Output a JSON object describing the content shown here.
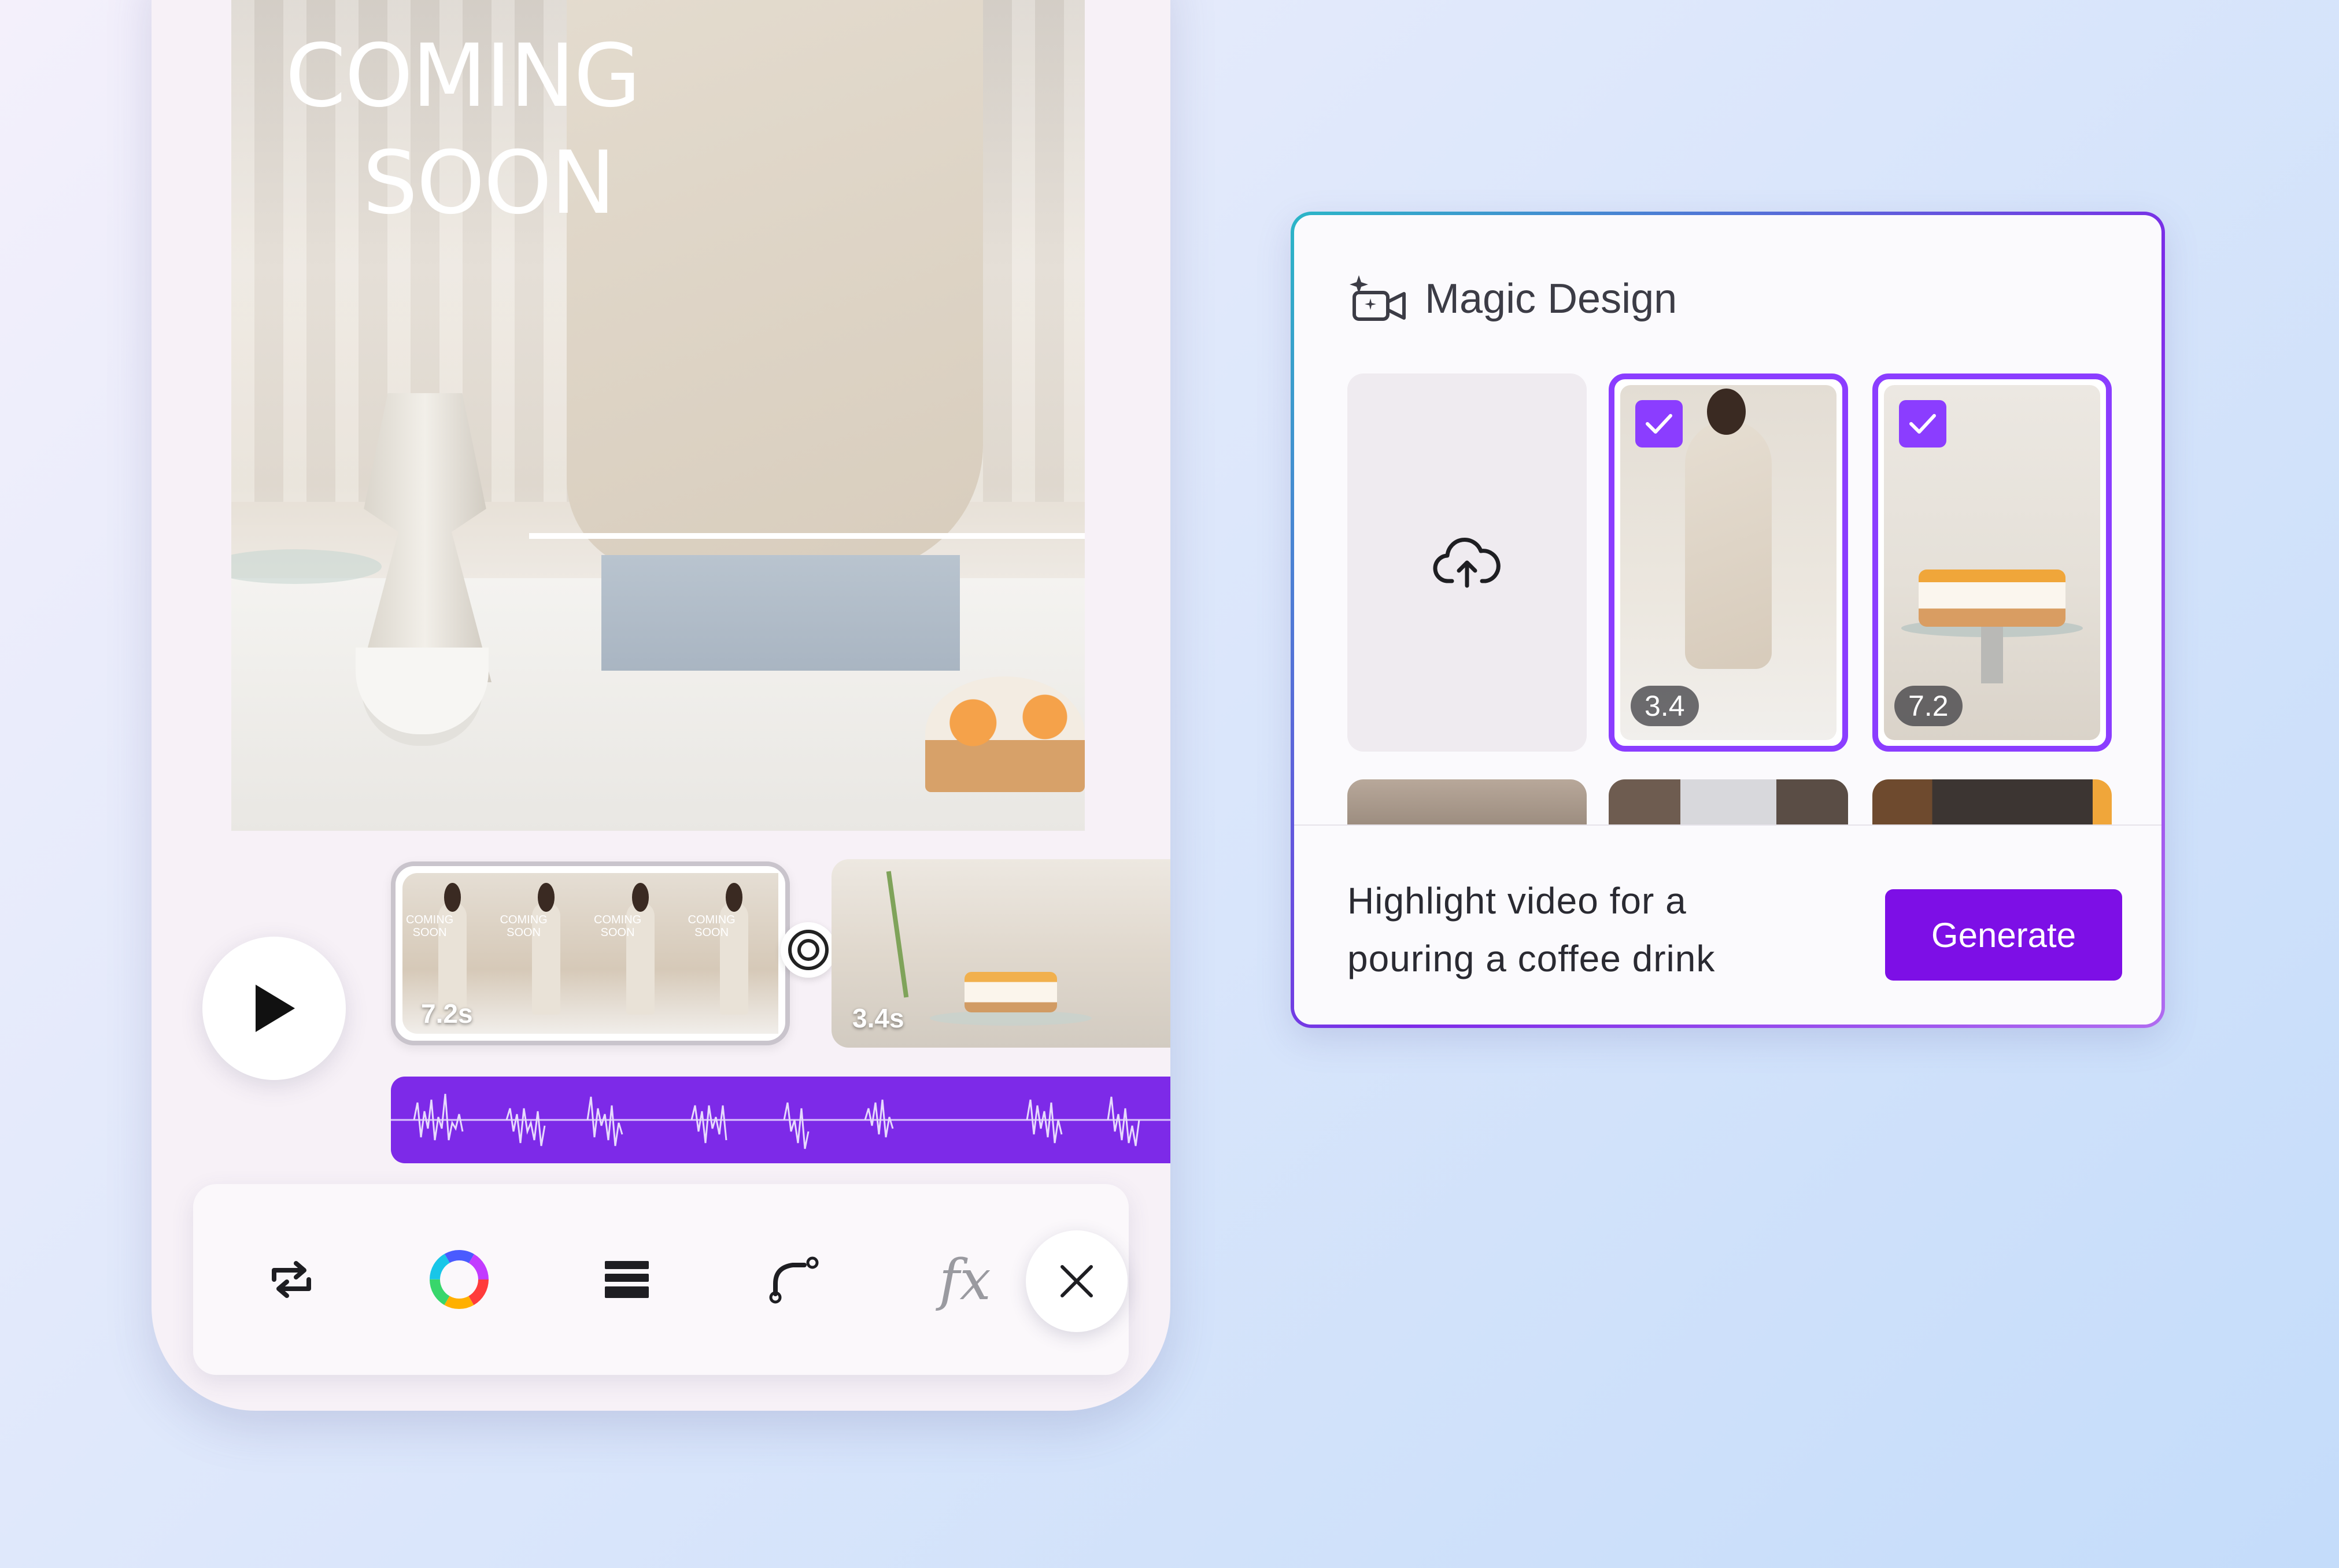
{
  "video": {
    "title_line1": "COMING",
    "title_line2": "SOON"
  },
  "timeline": {
    "clip1_duration": "7.2s",
    "clip1_thumb_text_line1": "COMING",
    "clip1_thumb_text_line2": "SOON",
    "clip2_duration": "3.4s"
  },
  "toolbar": {
    "tools": [
      "replace-icon",
      "color-wheel-icon",
      "layers-icon",
      "curve-icon",
      "effects-icon"
    ],
    "fx_label": "fx",
    "close_icon": "close-icon"
  },
  "panel": {
    "title": "Magic Design",
    "tiles": [
      {
        "duration": "3.4",
        "selected": true
      },
      {
        "duration": "7.2",
        "selected": true
      }
    ],
    "prompt_line1": "Highlight video for a",
    "prompt_line2": "pouring a coffee drink",
    "generate_label": "Generate"
  },
  "colors": {
    "accent": "#7d2ae8",
    "generate_button": "#7d0fe6",
    "selection_border": "#8b3dff"
  }
}
